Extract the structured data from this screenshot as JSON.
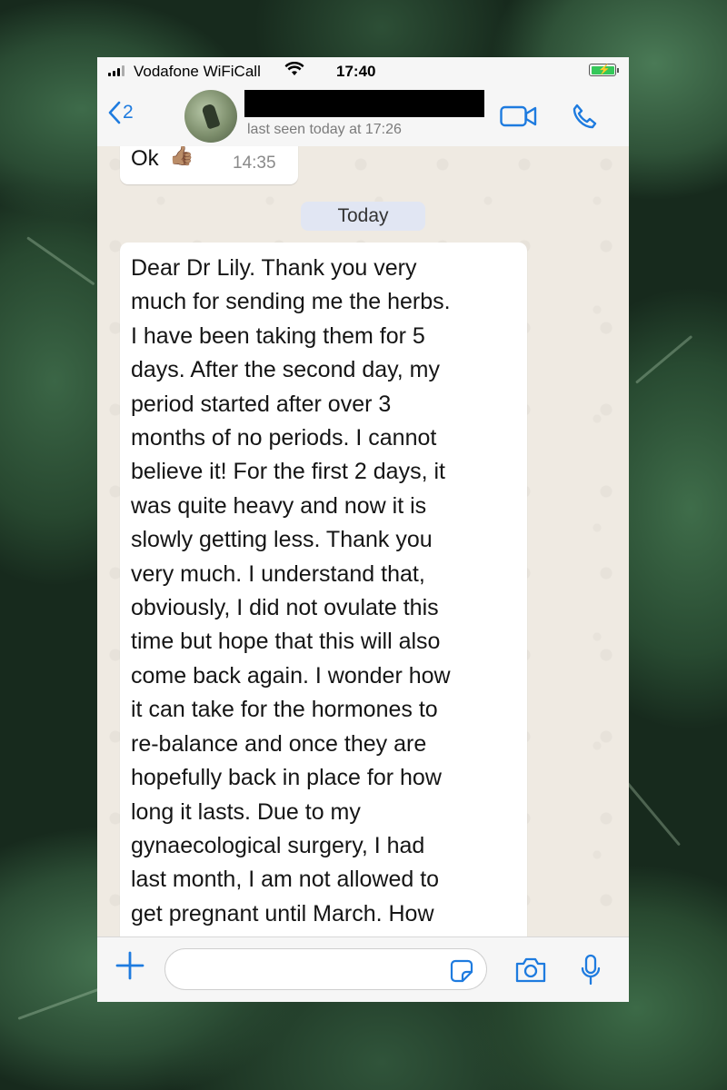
{
  "status_bar": {
    "carrier": "Vodafone WiFiCall",
    "time": "17:40"
  },
  "header": {
    "back_count": "2",
    "last_seen": "last seen today at 17:26"
  },
  "chat": {
    "previous_message": {
      "text": "Ok",
      "emoji": "👍🏽",
      "time": "14:35"
    },
    "day_separator": "Today",
    "message": {
      "text": "Dear Dr Lily. Thank you very\nmuch for sending me the herbs.\nI have been taking them for 5\ndays. After the second day, my\nperiod started after over 3\nmonths of no periods. I cannot\nbelieve it!  For the first 2 days, it\nwas quite heavy and now it is\nslowly getting less. Thank you\nvery much. I understand that,\nobviously, I did not ovulate this\ntime but hope that this will also\ncome back again. I wonder how\nit can take for the hormones to\nre-balance and once they are\nhopefully back in place for how\nlong it lasts. Due to my\ngynaecological surgery, I had\nlast month, I am not allowed to\nget pregnant until  March. How"
    }
  },
  "input": {
    "placeholder": ""
  },
  "colors": {
    "accent": "#1e7bdf",
    "chat_background": "#efeae2",
    "incoming_bubble": "#ffffff",
    "day_chip": "#e1e6f3",
    "battery": "#35c85a"
  },
  "icons": {
    "signal": "signal-icon",
    "wifi": "wifi-icon",
    "battery": "battery-charging-icon",
    "back": "chevron-left-icon",
    "video": "video-call-icon",
    "phone": "phone-call-icon",
    "plus": "plus-icon",
    "sticker": "sticker-icon",
    "camera": "camera-icon",
    "mic": "microphone-icon"
  }
}
